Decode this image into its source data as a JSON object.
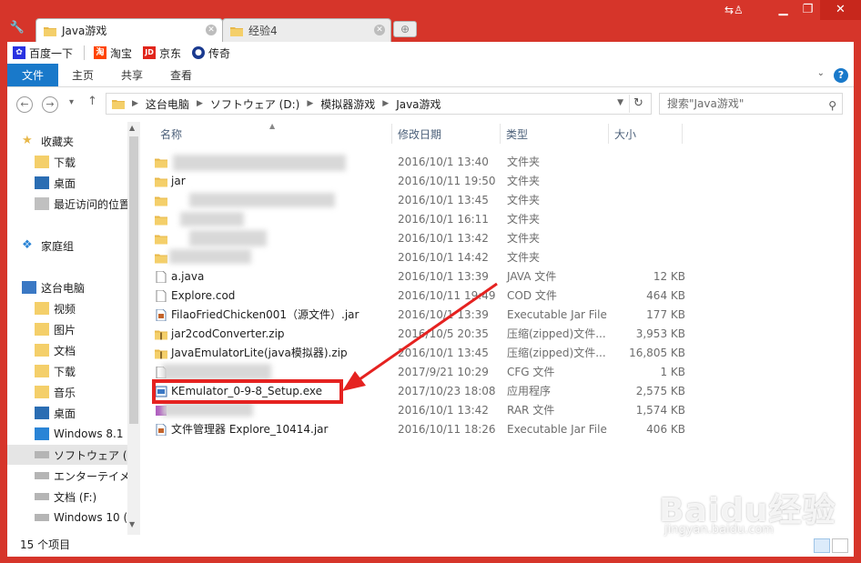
{
  "tabs": [
    {
      "label": "Java游戏",
      "active": true
    },
    {
      "label": "经验4",
      "active": false
    }
  ],
  "bookmarks": [
    {
      "label": "百度一下",
      "color": "#2932e1",
      "glyph": "✿"
    },
    {
      "label": "淘宝",
      "color": "#ff4400",
      "glyph": "淘"
    },
    {
      "label": "京东",
      "color": "#e1251b",
      "glyph": "JD"
    },
    {
      "label": "传奇",
      "color": "#1a3a8f",
      "glyph": "●"
    }
  ],
  "ribbon": {
    "file": "文件",
    "home": "主页",
    "share": "共享",
    "view": "查看"
  },
  "address": {
    "crumbs": [
      "这台电脑",
      "ソフトウェア (D:)",
      "模拟器游戏",
      "Java游戏"
    ]
  },
  "search": {
    "placeholder": "搜索\"Java游戏\""
  },
  "navpane": {
    "favorites": "收藏夹",
    "downloads": "下载",
    "desktop": "桌面",
    "recent": "最近访问的位置",
    "homegroup": "家庭组",
    "thispc": "这台电脑",
    "videos": "视频",
    "pictures": "图片",
    "documents": "文档",
    "downloads2": "下载",
    "music": "音乐",
    "desktop2": "桌面",
    "drive_c": "Windows 8.1 (",
    "drive_d": "ソフトウェア (",
    "drive_e": "エンターテイメ",
    "drive_f": "文档 (F:)",
    "drive_g": "Windows 10 ("
  },
  "columns": {
    "name": "名称",
    "date": "修改日期",
    "type": "类型",
    "size": "大小"
  },
  "files": [
    {
      "name": "",
      "date": "2016/10/1 13:40",
      "type": "文件夹",
      "size": ""
    },
    {
      "name": "jar",
      "date": "2016/10/11 19:50",
      "type": "文件夹",
      "size": ""
    },
    {
      "name": "",
      "date": "2016/10/1 13:45",
      "type": "文件夹",
      "size": ""
    },
    {
      "name": "",
      "date": "2016/10/1 16:11",
      "type": "文件夹",
      "size": ""
    },
    {
      "name": "",
      "date": "2016/10/1 13:42",
      "type": "文件夹",
      "size": ""
    },
    {
      "name": "",
      "date": "2016/10/1 14:42",
      "type": "文件夹",
      "size": ""
    },
    {
      "name": "a.java",
      "date": "2016/10/1 13:39",
      "type": "JAVA 文件",
      "size": "12 KB"
    },
    {
      "name": "Explore.cod",
      "date": "2016/10/11 19:49",
      "type": "COD 文件",
      "size": "464 KB"
    },
    {
      "name": "FilaoFriedChicken001（源文件）.jar",
      "date": "2016/10/1 13:39",
      "type": "Executable Jar File",
      "size": "177 KB"
    },
    {
      "name": "jar2codConverter.zip",
      "date": "2016/10/5 20:35",
      "type": "压缩(zipped)文件...",
      "size": "3,953 KB"
    },
    {
      "name": "JavaEmulatorLite(java模拟器).zip",
      "date": "2016/10/1 13:45",
      "type": "压缩(zipped)文件...",
      "size": "16,805 KB"
    },
    {
      "name": "",
      "date": "2017/9/21 10:29",
      "type": "CFG 文件",
      "size": "1 KB"
    },
    {
      "name": "KEmulator_0-9-8_Setup.exe",
      "date": "2017/10/23 18:08",
      "type": "应用程序",
      "size": "2,575 KB"
    },
    {
      "name": "",
      "date": "2016/10/1 13:42",
      "type": "RAR 文件",
      "size": "1,574 KB"
    },
    {
      "name": "文件管理器 Explore_10414.jar",
      "date": "2016/10/11 18:26",
      "type": "Executable Jar File",
      "size": "406 KB"
    }
  ],
  "status": {
    "item_count": "15 个项目"
  },
  "watermark": {
    "main": "Baidu经验",
    "sub": "jingyan.baidu.com"
  }
}
